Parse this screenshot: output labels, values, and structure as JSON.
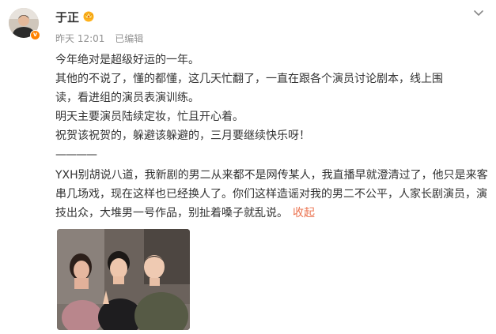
{
  "post": {
    "author": "于正",
    "time": "昨天 12:01",
    "edited": "已编辑",
    "lines": [
      "今年绝对是超级好运的一年。",
      "其他的不说了，懂的都懂，这几天忙翻了，一直在跟各个演员讨论剧本，线上围",
      "读，看进组的演员表演训练。",
      "明天主要演员陆续定妆，忙且开心着。",
      "祝贺该祝贺的，躲避该躲避的，三月要继续快乐呀！",
      "————"
    ],
    "paragraph2": "YXH别胡说八道，我新剧的男二从来都不是网传某人，我直播早就澄清过了，他只是来客串几场戏，现在这样也已经换人了。你们这样造谣对我的男二不公平，人家长剧演员，演技出众，大堆男一号作品，别扯着嗓子就乱说。",
    "collapse_label": "收起"
  },
  "icons": {
    "vip": "crown-badge-icon",
    "verified": "verified-v-icon",
    "menu": "chevron-down-icon"
  },
  "colors": {
    "link": "#eb7350",
    "meta": "#939393",
    "text": "#333333",
    "verified": "#ff8200"
  }
}
